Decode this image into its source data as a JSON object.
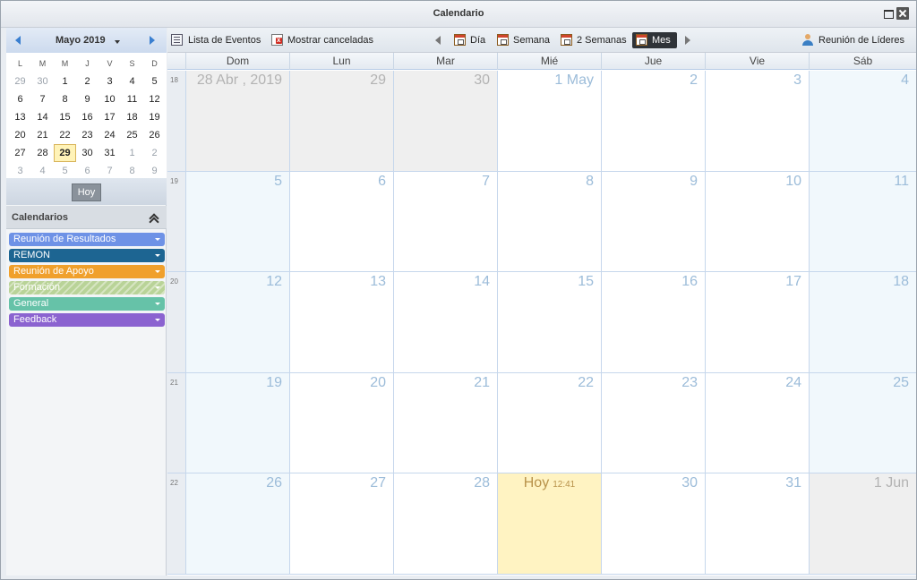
{
  "window": {
    "title": "Calendario"
  },
  "mini_calendar": {
    "month_label": "Mayo 2019",
    "weekdays": [
      "L",
      "M",
      "M",
      "J",
      "V",
      "S",
      "D"
    ],
    "weeks": [
      [
        "29",
        "30",
        "1",
        "2",
        "3",
        "4",
        "5"
      ],
      [
        "6",
        "7",
        "8",
        "9",
        "10",
        "11",
        "12"
      ],
      [
        "13",
        "14",
        "15",
        "16",
        "17",
        "18",
        "19"
      ],
      [
        "20",
        "21",
        "22",
        "23",
        "24",
        "25",
        "26"
      ],
      [
        "27",
        "28",
        "29",
        "30",
        "31",
        "1",
        "2"
      ],
      [
        "3",
        "4",
        "5",
        "6",
        "7",
        "8",
        "9"
      ]
    ],
    "today_button": "Hoy"
  },
  "calendars": {
    "title": "Calendarios",
    "items": [
      {
        "name": "Reunión de Resultados",
        "color": "#6e92e6"
      },
      {
        "name": "REMON",
        "color": "#1d6592"
      },
      {
        "name": "Reunión de Apoyo",
        "color": "#f0a02c"
      },
      {
        "name": "Formación",
        "color": "#b9d398"
      },
      {
        "name": "General",
        "color": "#66c2a8"
      },
      {
        "name": "Feedback",
        "color": "#8b63d0"
      }
    ]
  },
  "toolbar": {
    "event_list": "Lista de Eventos",
    "show_cancelled": "Mostrar canceladas",
    "day": "Día",
    "week": "Semana",
    "two_weeks": "2 Semanas",
    "month": "Mes",
    "leaders_meeting": "Reunión de Líderes"
  },
  "month_view": {
    "weekdays": [
      "Dom",
      "Lun",
      "Mar",
      "Mié",
      "Jue",
      "Vie",
      "Sáb"
    ],
    "weeks": [
      {
        "number": "18",
        "days": [
          {
            "label": "28 Abr , 2019",
            "type": "other"
          },
          {
            "label": "29",
            "type": "other"
          },
          {
            "label": "30",
            "type": "other"
          },
          {
            "label": "1 May",
            "type": "normal"
          },
          {
            "label": "2",
            "type": "normal"
          },
          {
            "label": "3",
            "type": "normal"
          },
          {
            "label": "4",
            "type": "weekend"
          }
        ]
      },
      {
        "number": "19",
        "days": [
          {
            "label": "5",
            "type": "weekend"
          },
          {
            "label": "6",
            "type": "normal"
          },
          {
            "label": "7",
            "type": "normal"
          },
          {
            "label": "8",
            "type": "normal"
          },
          {
            "label": "9",
            "type": "normal"
          },
          {
            "label": "10",
            "type": "normal"
          },
          {
            "label": "11",
            "type": "weekend"
          }
        ]
      },
      {
        "number": "20",
        "days": [
          {
            "label": "12",
            "type": "weekend"
          },
          {
            "label": "13",
            "type": "normal"
          },
          {
            "label": "14",
            "type": "normal"
          },
          {
            "label": "15",
            "type": "normal"
          },
          {
            "label": "16",
            "type": "normal"
          },
          {
            "label": "17",
            "type": "normal"
          },
          {
            "label": "18",
            "type": "weekend"
          }
        ]
      },
      {
        "number": "21",
        "days": [
          {
            "label": "19",
            "type": "weekend"
          },
          {
            "label": "20",
            "type": "normal"
          },
          {
            "label": "21",
            "type": "normal"
          },
          {
            "label": "22",
            "type": "normal"
          },
          {
            "label": "23",
            "type": "normal"
          },
          {
            "label": "24",
            "type": "normal"
          },
          {
            "label": "25",
            "type": "weekend"
          }
        ]
      },
      {
        "number": "22",
        "days": [
          {
            "label": "26",
            "type": "weekend"
          },
          {
            "label": "27",
            "type": "normal"
          },
          {
            "label": "28",
            "type": "normal"
          },
          {
            "label": "Hoy",
            "time": "12:41",
            "type": "today"
          },
          {
            "label": "30",
            "type": "normal"
          },
          {
            "label": "31",
            "type": "normal"
          },
          {
            "label": "1 Jun",
            "type": "other"
          }
        ]
      }
    ]
  }
}
